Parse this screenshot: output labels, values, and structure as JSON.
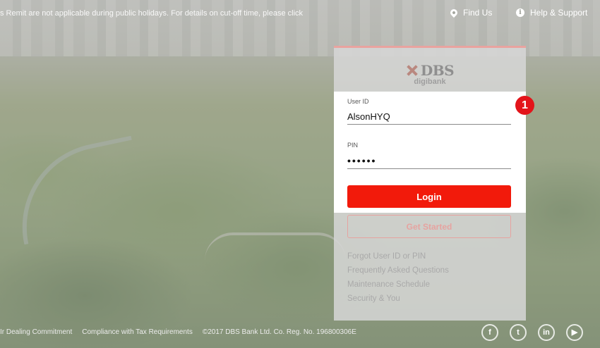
{
  "topbar": {
    "notice": "s Remit are not applicable during public holidays. For details on cut-off time, please click",
    "find_us": "Find Us",
    "help": "Help & Support",
    "find_icon": "location-pin-icon",
    "help_icon": "info-icon"
  },
  "logo": {
    "brand": "DBS",
    "sub": "digibank"
  },
  "form": {
    "user_label": "User ID",
    "user_value": "AlsonHYQ",
    "pin_label": "PIN",
    "pin_value": "••••••",
    "login_label": "Login",
    "get_started_label": "Get Started"
  },
  "links": [
    "Forgot User ID or PIN",
    "Frequently Asked Questions",
    "Maintenance Schedule",
    "Security & You"
  ],
  "step_badge": "1",
  "footer": {
    "items": [
      "Ir Dealing Commitment",
      "Compliance with Tax Requirements",
      "©2017 DBS Bank Ltd. Co. Reg. No. 196800306E"
    ]
  },
  "social": [
    "facebook-icon",
    "twitter-icon",
    "linkedin-icon",
    "youtube-icon"
  ],
  "colors": {
    "accent": "#f21a0b",
    "badge": "#e3141a",
    "panel_border": "#e9a39f"
  }
}
